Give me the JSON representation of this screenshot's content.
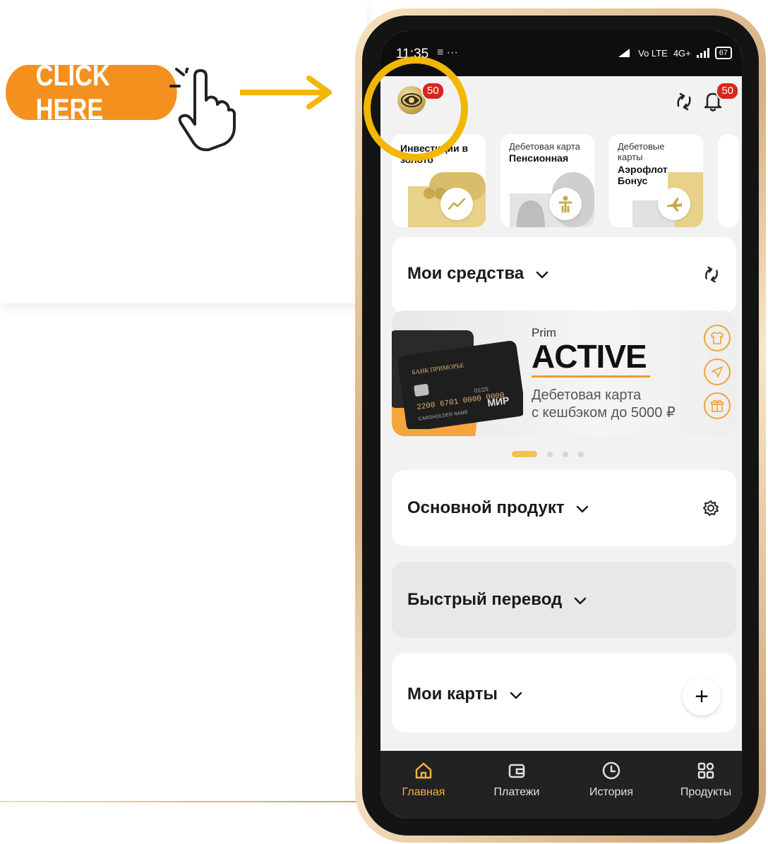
{
  "promo": {
    "click_here_label": "CLICK HERE"
  },
  "status_bar": {
    "time": "11:35",
    "notif_icons": "≡ ···",
    "network": "4G+",
    "volte": "Vo LTE",
    "battery": "67"
  },
  "header": {
    "avatar_badge": "50",
    "bell_badge": "50"
  },
  "stories": [
    {
      "caption": "",
      "title": "Инвестиции в золото"
    },
    {
      "caption": "Дебетовая карта",
      "title": "Пенсионная"
    },
    {
      "caption": "Дебетовые карты",
      "title": "Аэрофлот Бонус"
    }
  ],
  "sections": {
    "my_funds": "Мои средства",
    "main_product": "Основной продукт",
    "quick_transfer": "Быстрый перевод",
    "my_cards": "Мои карты",
    "add_symbol": "+"
  },
  "banner": {
    "prim": "Prim",
    "title": "ACTIVE",
    "subtitle_line1": "Дебетовая карта",
    "subtitle_line2": "с кешбэком до 5000 ₽",
    "card_bank": "БАНК ПРИМОРЬЕ",
    "card_number": "2200 6701 0000 0000",
    "card_expiry": "01/25",
    "card_holder": "CARDHOLDER NAME",
    "card_brand": "МИР"
  },
  "carousel": {
    "total": 4,
    "active": 0
  },
  "bottom_nav": [
    {
      "label": "Главная",
      "active": true,
      "icon": "home-icon"
    },
    {
      "label": "Платежи",
      "active": false,
      "icon": "wallet-icon"
    },
    {
      "label": "История",
      "active": false,
      "icon": "clock-icon"
    },
    {
      "label": "Продукты",
      "active": false,
      "icon": "grid-icon"
    }
  ],
  "colors": {
    "accent_orange": "#f4901e",
    "highlight_ring": "#f2b705",
    "badge_red": "#d9261c",
    "nav_active": "#f2b33a"
  }
}
